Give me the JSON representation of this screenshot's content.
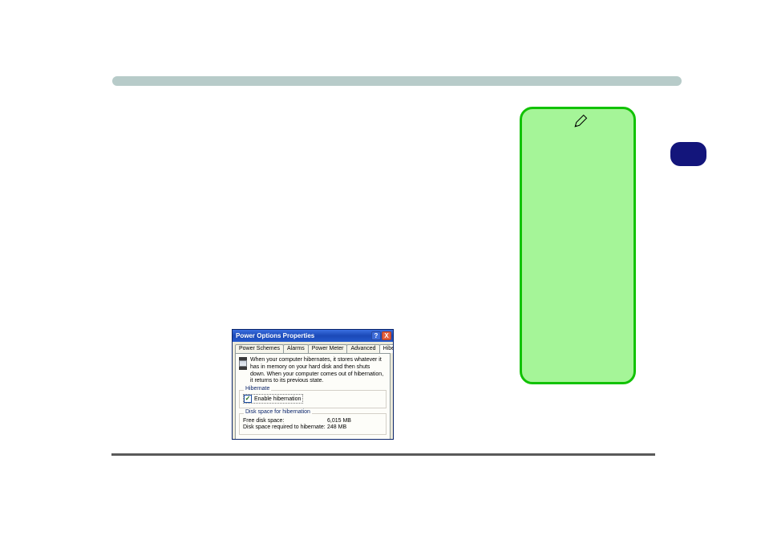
{
  "dialog": {
    "title": "Power Options Properties",
    "help_btn": "?",
    "close_btn": "X",
    "tabs": [
      "Power Schemes",
      "Alarms",
      "Power Meter",
      "Advanced",
      "Hibernate"
    ],
    "active_tab_index": 4,
    "description": "When your computer hibernates, it stores whatever it has in memory on your hard disk and then shuts down. When your computer comes out of hibernation, it returns to its previous state.",
    "hibernate_group": {
      "title": "Hibernate",
      "checkbox_label": "Enable hibernation",
      "checked": true
    },
    "disk_group": {
      "title": "Disk space for hibernation",
      "rows": [
        {
          "label": "Free disk space:",
          "value": "6,015 MB"
        },
        {
          "label": "Disk space required to hibernate:",
          "value": "248 MB"
        }
      ]
    }
  },
  "icons": {
    "pen": "pen-icon"
  }
}
